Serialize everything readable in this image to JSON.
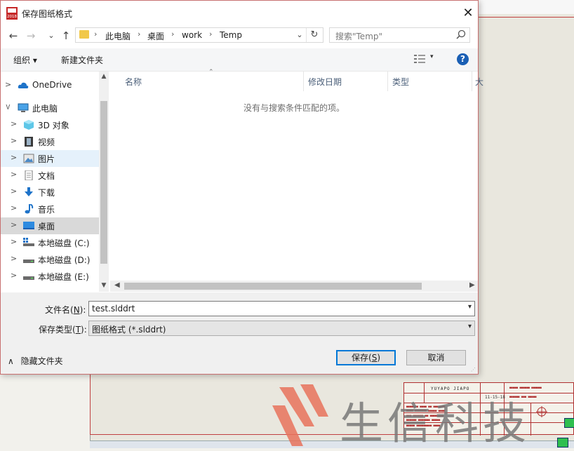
{
  "dialog": {
    "title": "保存图纸格式",
    "close_label": "✕",
    "app_icon_label": "2018"
  },
  "nav": {
    "back": "←",
    "forward": "→",
    "recent": "⌄",
    "up": "↑"
  },
  "address": {
    "crumbs": [
      "此电脑",
      "桌面",
      "work",
      "Temp"
    ],
    "separator": "›",
    "dropdown": "⌄",
    "refresh": "↻"
  },
  "search": {
    "placeholder": "搜索\"Temp\"",
    "icon": "search-icon"
  },
  "toolbar": {
    "organize": "组织 ▾",
    "new_folder": "新建文件夹",
    "view_caret": "▾",
    "help": "?"
  },
  "tree": [
    {
      "label": "OneDrive",
      "icon": "cloud-icon"
    },
    {
      "label": "此电脑",
      "icon": "computer-icon"
    },
    {
      "label": "3D 对象",
      "icon": "cube-icon"
    },
    {
      "label": "视频",
      "icon": "video-icon"
    },
    {
      "label": "图片",
      "icon": "picture-icon"
    },
    {
      "label": "文档",
      "icon": "document-icon"
    },
    {
      "label": "下载",
      "icon": "download-icon"
    },
    {
      "label": "音乐",
      "icon": "music-icon"
    },
    {
      "label": "桌面",
      "icon": "desktop-icon"
    },
    {
      "label": "本地磁盘 (C:)",
      "icon": "drive-c-icon"
    },
    {
      "label": "本地磁盘 (D:)",
      "icon": "drive-icon"
    },
    {
      "label": "本地磁盘 (E:)",
      "icon": "drive-icon"
    }
  ],
  "columns": {
    "name": "名称",
    "modified": "修改日期",
    "type": "类型",
    "size": "大"
  },
  "empty_message": "没有与搜索条件匹配的项。",
  "form": {
    "filename_label_pre": "文件名(",
    "filename_label_key": "N",
    "filename_label_post": "):",
    "filename_value": "test.slddrt",
    "filetype_label_pre": "保存类型(",
    "filetype_label_key": "T",
    "filetype_label_post": "):",
    "filetype_value": "图纸格式 (*.slddrt)",
    "hide_folders": "隐藏文件夹",
    "save_pre": "保存(",
    "save_key": "S",
    "save_post": ")",
    "cancel": "取消"
  },
  "background": {
    "watermark_text": "生信科技",
    "titleblock_header": "YUYAPO JIAPO",
    "titleblock_date": "11-15-18"
  },
  "colors": {
    "accent": "#0078d7",
    "selected": "#d9d9d9",
    "hover": "#e5f1fb",
    "drawing_border": "#c04040"
  }
}
